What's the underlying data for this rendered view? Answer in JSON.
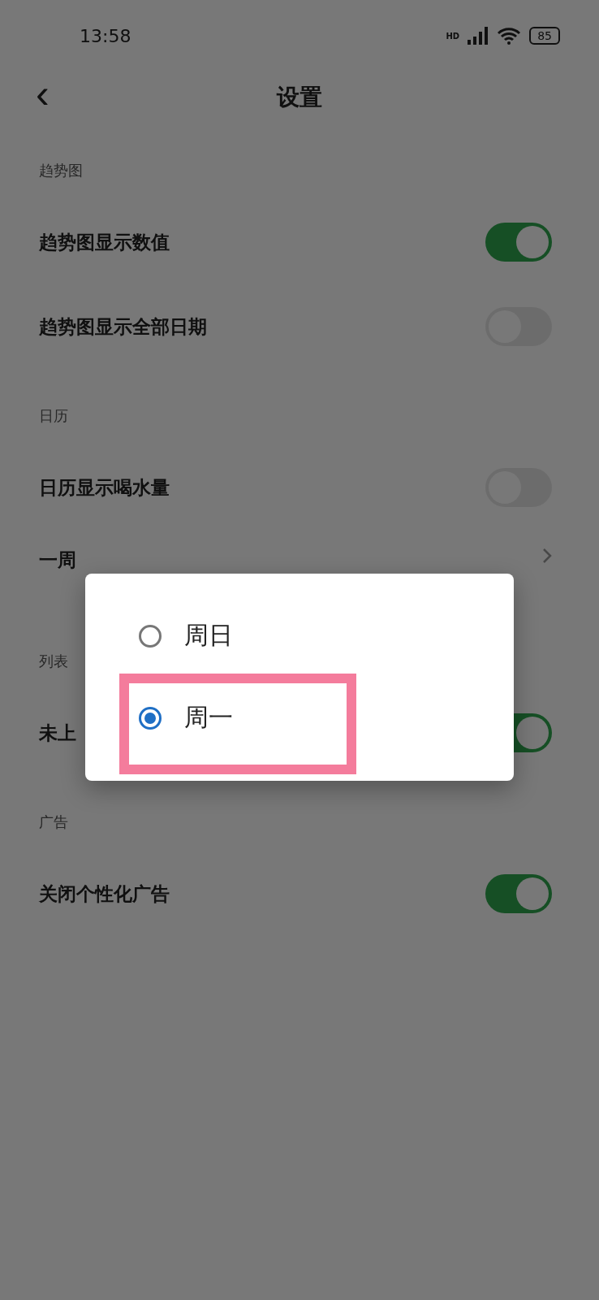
{
  "status_bar": {
    "time": "13:58",
    "network": "HD",
    "battery": "85"
  },
  "header": {
    "back": "‹",
    "title": "设置"
  },
  "sections": [
    {
      "title": "趋势图",
      "rows": [
        {
          "kind": "toggle",
          "label": "趋势图显示数值",
          "on": true
        },
        {
          "kind": "toggle",
          "label": "趋势图显示全部日期",
          "on": false
        }
      ]
    },
    {
      "title": "日历",
      "rows": [
        {
          "kind": "toggle",
          "label": "日历显示喝水量",
          "on": false
        },
        {
          "kind": "select",
          "label": "一周"
        }
      ]
    },
    {
      "title": "列表",
      "rows": [
        {
          "kind": "toggle",
          "label": "未上",
          "on": true
        }
      ]
    },
    {
      "title": "广告",
      "rows": [
        {
          "kind": "toggle",
          "label": "关闭个性化广告",
          "on": true
        }
      ]
    }
  ],
  "dialog": {
    "options": [
      {
        "label": "周日",
        "selected": false,
        "highlighted": false
      },
      {
        "label": "周一",
        "selected": true,
        "highlighted": true
      }
    ]
  }
}
